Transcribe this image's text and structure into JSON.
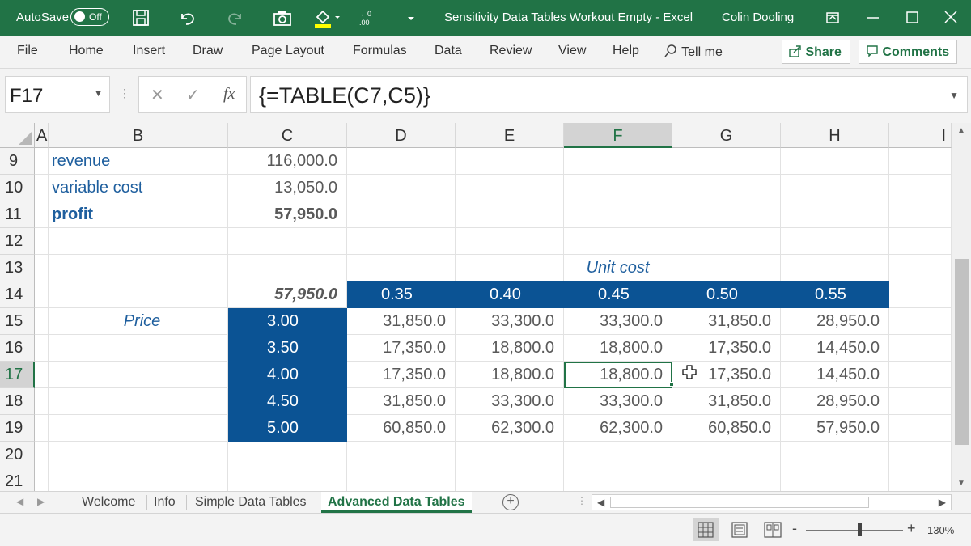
{
  "titlebar": {
    "autosave_label": "AutoSave",
    "autosave_state": "Off",
    "document_title": "Sensitivity Data Tables Workout Empty  -  Excel",
    "user_name": "Colin Dooling",
    "accent_color": "#217346"
  },
  "ribbon": {
    "tabs": [
      "File",
      "Home",
      "Insert",
      "Draw",
      "Page Layout",
      "Formulas",
      "Data",
      "Review",
      "View",
      "Help"
    ],
    "tell_me": "Tell me",
    "share": "Share",
    "comments": "Comments"
  },
  "formula_bar": {
    "name_box": "F17",
    "fx_symbol": "fx",
    "formula": "{=TABLE(C7,C5)}"
  },
  "grid": {
    "columns": [
      "A",
      "B",
      "C",
      "D",
      "E",
      "F",
      "G",
      "H",
      "I"
    ],
    "selected_column": "F",
    "rows": [
      "9",
      "10",
      "11",
      "12",
      "13",
      "14",
      "15",
      "16",
      "17",
      "18",
      "19",
      "20",
      "21"
    ],
    "selected_row": "17",
    "labels": {
      "revenue": "revenue",
      "variable_cost": "variable cost",
      "profit": "profit",
      "price": "Price",
      "unit_cost": "Unit cost"
    },
    "values": {
      "revenue": "116,000.0",
      "variable_cost": "13,050.0",
      "profit": "57,950.0",
      "table_corner": "57,950.0"
    },
    "unit_costs": [
      "0.35",
      "0.40",
      "0.45",
      "0.50",
      "0.55"
    ],
    "prices": [
      "3.00",
      "3.50",
      "4.00",
      "4.50",
      "5.00"
    ],
    "table": [
      [
        "31,850.0",
        "33,300.0",
        "33,300.0",
        "31,850.0",
        "28,950.0"
      ],
      [
        "17,350.0",
        "18,800.0",
        "18,800.0",
        "17,350.0",
        "14,450.0"
      ],
      [
        "17,350.0",
        "18,800.0",
        "18,800.0",
        "17,350.0",
        "14,450.0"
      ],
      [
        "31,850.0",
        "33,300.0",
        "33,300.0",
        "31,850.0",
        "28,950.0"
      ],
      [
        "60,850.0",
        "62,300.0",
        "62,300.0",
        "60,850.0",
        "57,950.0"
      ]
    ],
    "header_fill_color": "#0b5394"
  },
  "sheet_tabs": {
    "tabs": [
      "Welcome",
      "Info",
      "Simple Data Tables",
      "Advanced Data Tables"
    ],
    "active": "Advanced Data Tables"
  },
  "status_bar": {
    "zoom_level": "130%",
    "zoom_minus": "-",
    "zoom_plus": "+"
  }
}
